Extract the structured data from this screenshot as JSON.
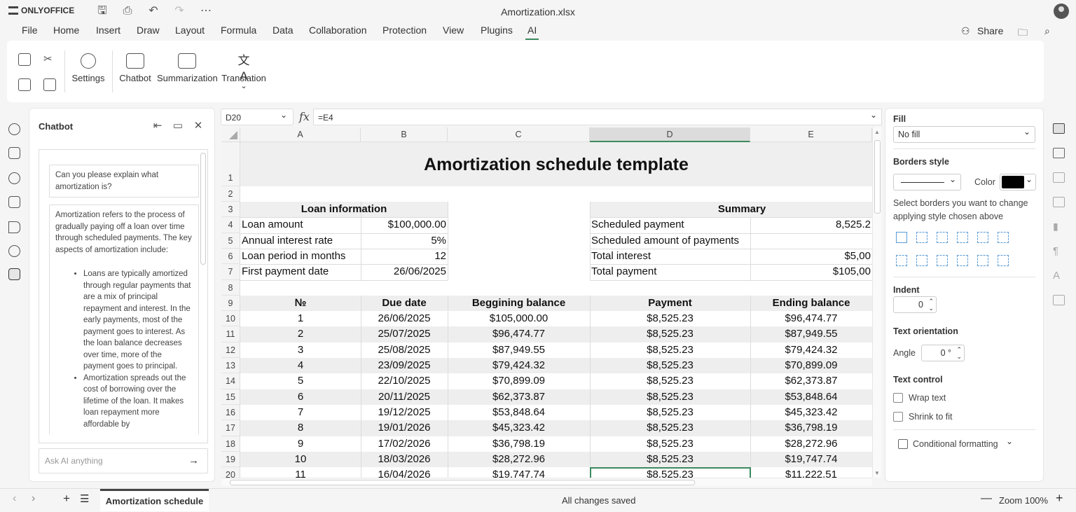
{
  "app": {
    "name": "ONLYOFFICE",
    "document_title": "Amortization.xlsx"
  },
  "menu": [
    "File",
    "Home",
    "Insert",
    "Draw",
    "Layout",
    "Formula",
    "Data",
    "Collaboration",
    "Protection",
    "View",
    "Plugins",
    "AI"
  ],
  "menu_right": {
    "share": "Share"
  },
  "ribbon": {
    "settings": "Settings",
    "chatbot": "Chatbot",
    "summarization": "Summarization",
    "translation": "Translation"
  },
  "chat": {
    "title": "Chatbot",
    "question": "Can you please explain what amortization is?",
    "answer_intro": "Amortization refers to the process of gradually paying off a loan over time through scheduled payments. The key aspects of amortization include:",
    "bullets": [
      "Loans are typically amortized through regular payments that are a mix of principal repayment and interest. In the early payments, most of the payment goes to interest. As the loan balance decreases over time, more of the payment goes to principal.",
      "Amortization spreads out the cost of borrowing over the lifetime of the loan. It makes loan repayment more affordable by"
    ],
    "input_placeholder": "Ask AI anything"
  },
  "formula_bar": {
    "cell_ref": "D20",
    "fx": "fx",
    "formula": "=E4"
  },
  "sheet": {
    "columns": [
      "A",
      "B",
      "C",
      "D",
      "E"
    ],
    "selected_column": "D",
    "rows": [
      "1",
      "2",
      "3",
      "4",
      "5",
      "6",
      "7",
      "8",
      "9",
      "10",
      "11",
      "12",
      "13",
      "14",
      "15",
      "16",
      "17",
      "18",
      "19",
      "20"
    ],
    "title": "Amortization schedule template",
    "loan_info": {
      "header": "Loan information",
      "items": [
        {
          "label": "Loan amount",
          "value": "$100,000.00"
        },
        {
          "label": "Annual interest rate",
          "value": "5%"
        },
        {
          "label": "Loan period in months",
          "value": "12"
        },
        {
          "label": "First payment date",
          "value": "26/06/2025"
        }
      ]
    },
    "summary": {
      "header": "Summary",
      "items": [
        {
          "label": "Scheduled payment",
          "value": "8,525.2"
        },
        {
          "label": "Scheduled amount of payments",
          "value": ""
        },
        {
          "label": "Total interest",
          "value": "$5,00"
        },
        {
          "label": "Total payment",
          "value": "$105,00"
        }
      ]
    },
    "table_headers": [
      "№",
      "Due date",
      "Beggining balance",
      "Payment",
      "Ending balance"
    ],
    "table_rows": [
      [
        "1",
        "26/06/2025",
        "$105,000.00",
        "$8,525.23",
        "$96,474.77"
      ],
      [
        "2",
        "25/07/2025",
        "$96,474.77",
        "$8,525.23",
        "$87,949.55"
      ],
      [
        "3",
        "25/08/2025",
        "$87,949.55",
        "$8,525.23",
        "$79,424.32"
      ],
      [
        "4",
        "23/09/2025",
        "$79,424.32",
        "$8,525.23",
        "$70,899.09"
      ],
      [
        "5",
        "22/10/2025",
        "$70,899.09",
        "$8,525.23",
        "$62,373.87"
      ],
      [
        "6",
        "20/11/2025",
        "$62,373.87",
        "$8,525.23",
        "$53,848.64"
      ],
      [
        "7",
        "19/12/2025",
        "$53,848.64",
        "$8,525.23",
        "$45,323.42"
      ],
      [
        "8",
        "19/01/2026",
        "$45,323.42",
        "$8,525.23",
        "$36,798.19"
      ],
      [
        "9",
        "17/02/2026",
        "$36,798.19",
        "$8,525.23",
        "$28,272.96"
      ],
      [
        "10",
        "18/03/2026",
        "$28,272.96",
        "$8,525.23",
        "$19,747.74"
      ],
      [
        "11",
        "16/04/2026",
        "$19,747.74",
        "$8,525.23",
        "$11,222.51"
      ]
    ]
  },
  "right_panel": {
    "fill_label": "Fill",
    "fill_value": "No fill",
    "borders_label": "Borders style",
    "color_label": "Color",
    "border_color": "#000000",
    "borders_hint": "Select borders you want to change applying style chosen above",
    "indent_label": "Indent",
    "indent_value": "0",
    "orientation_label": "Text orientation",
    "angle_label": "Angle",
    "angle_value": "0 °",
    "text_control_label": "Text control",
    "wrap_text": "Wrap text",
    "shrink_to_fit": "Shrink to fit",
    "conditional_formatting": "Conditional formatting"
  },
  "status": {
    "sheet_tab": "Amortization schedule",
    "save_state": "All changes saved",
    "zoom": "Zoom 100%"
  },
  "colors": {
    "accent": "#3c8a5e",
    "selected_border": "#3c8a5e"
  }
}
